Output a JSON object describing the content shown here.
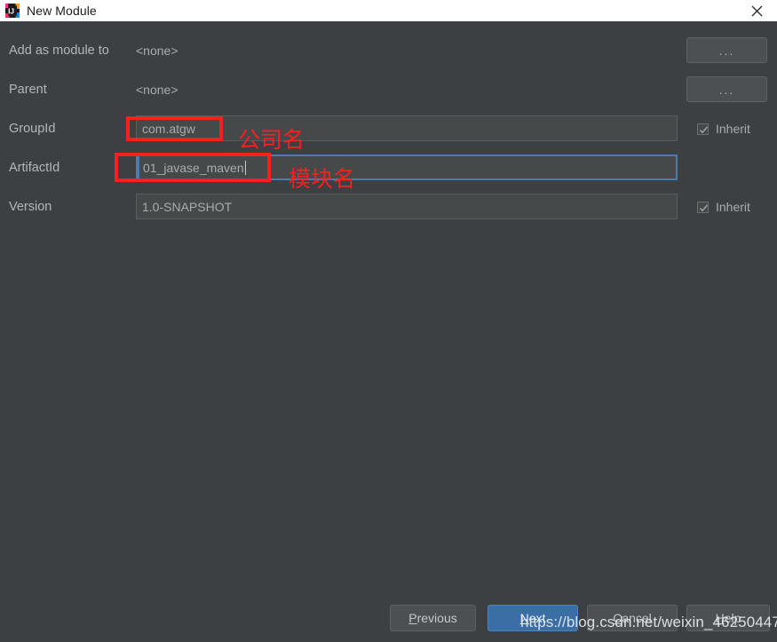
{
  "window": {
    "title": "New Module",
    "app_icon": "intellij-idea-icon",
    "close_icon": "close-icon",
    "titlebar_bg": "#ffffff",
    "dialog_bg": "#3c4043"
  },
  "form": {
    "rows": [
      {
        "label": "Add as module to",
        "type": "plain",
        "value": "<none>",
        "browse_label": "...",
        "has_browse": true,
        "has_inherit": false
      },
      {
        "label": "Parent",
        "type": "plain",
        "value": "<none>",
        "browse_label": "...",
        "has_browse": true,
        "has_inherit": false
      },
      {
        "label": "GroupId",
        "type": "field",
        "value": "com.atgw",
        "focused": false,
        "has_browse": false,
        "has_inherit": true,
        "inherit_label": "Inherit",
        "inherit_checked": true
      },
      {
        "label": "ArtifactId",
        "type": "field",
        "value": "01_javase_maven",
        "focused": true,
        "has_browse": false,
        "has_inherit": false
      },
      {
        "label": "Version",
        "type": "field",
        "value": "1.0-SNAPSHOT",
        "focused": false,
        "has_browse": false,
        "has_inherit": true,
        "inherit_label": "Inherit",
        "inherit_checked": true
      }
    ]
  },
  "annotations": {
    "color": "#f81f1f",
    "groupid_note": "公司名",
    "artifactid_note": "模块名"
  },
  "buttons": {
    "previous": {
      "label": "Previous",
      "mnemonic": "P"
    },
    "next": {
      "label": "Next",
      "mnemonic": "N",
      "accent": "#3a6ea5"
    },
    "cancel": {
      "label": "Cancel",
      "mnemonic": "C"
    },
    "help": {
      "label": "Help",
      "mnemonic": "H"
    }
  },
  "watermark": {
    "text": "https://blog.csdn.net/weixin_46250447"
  }
}
